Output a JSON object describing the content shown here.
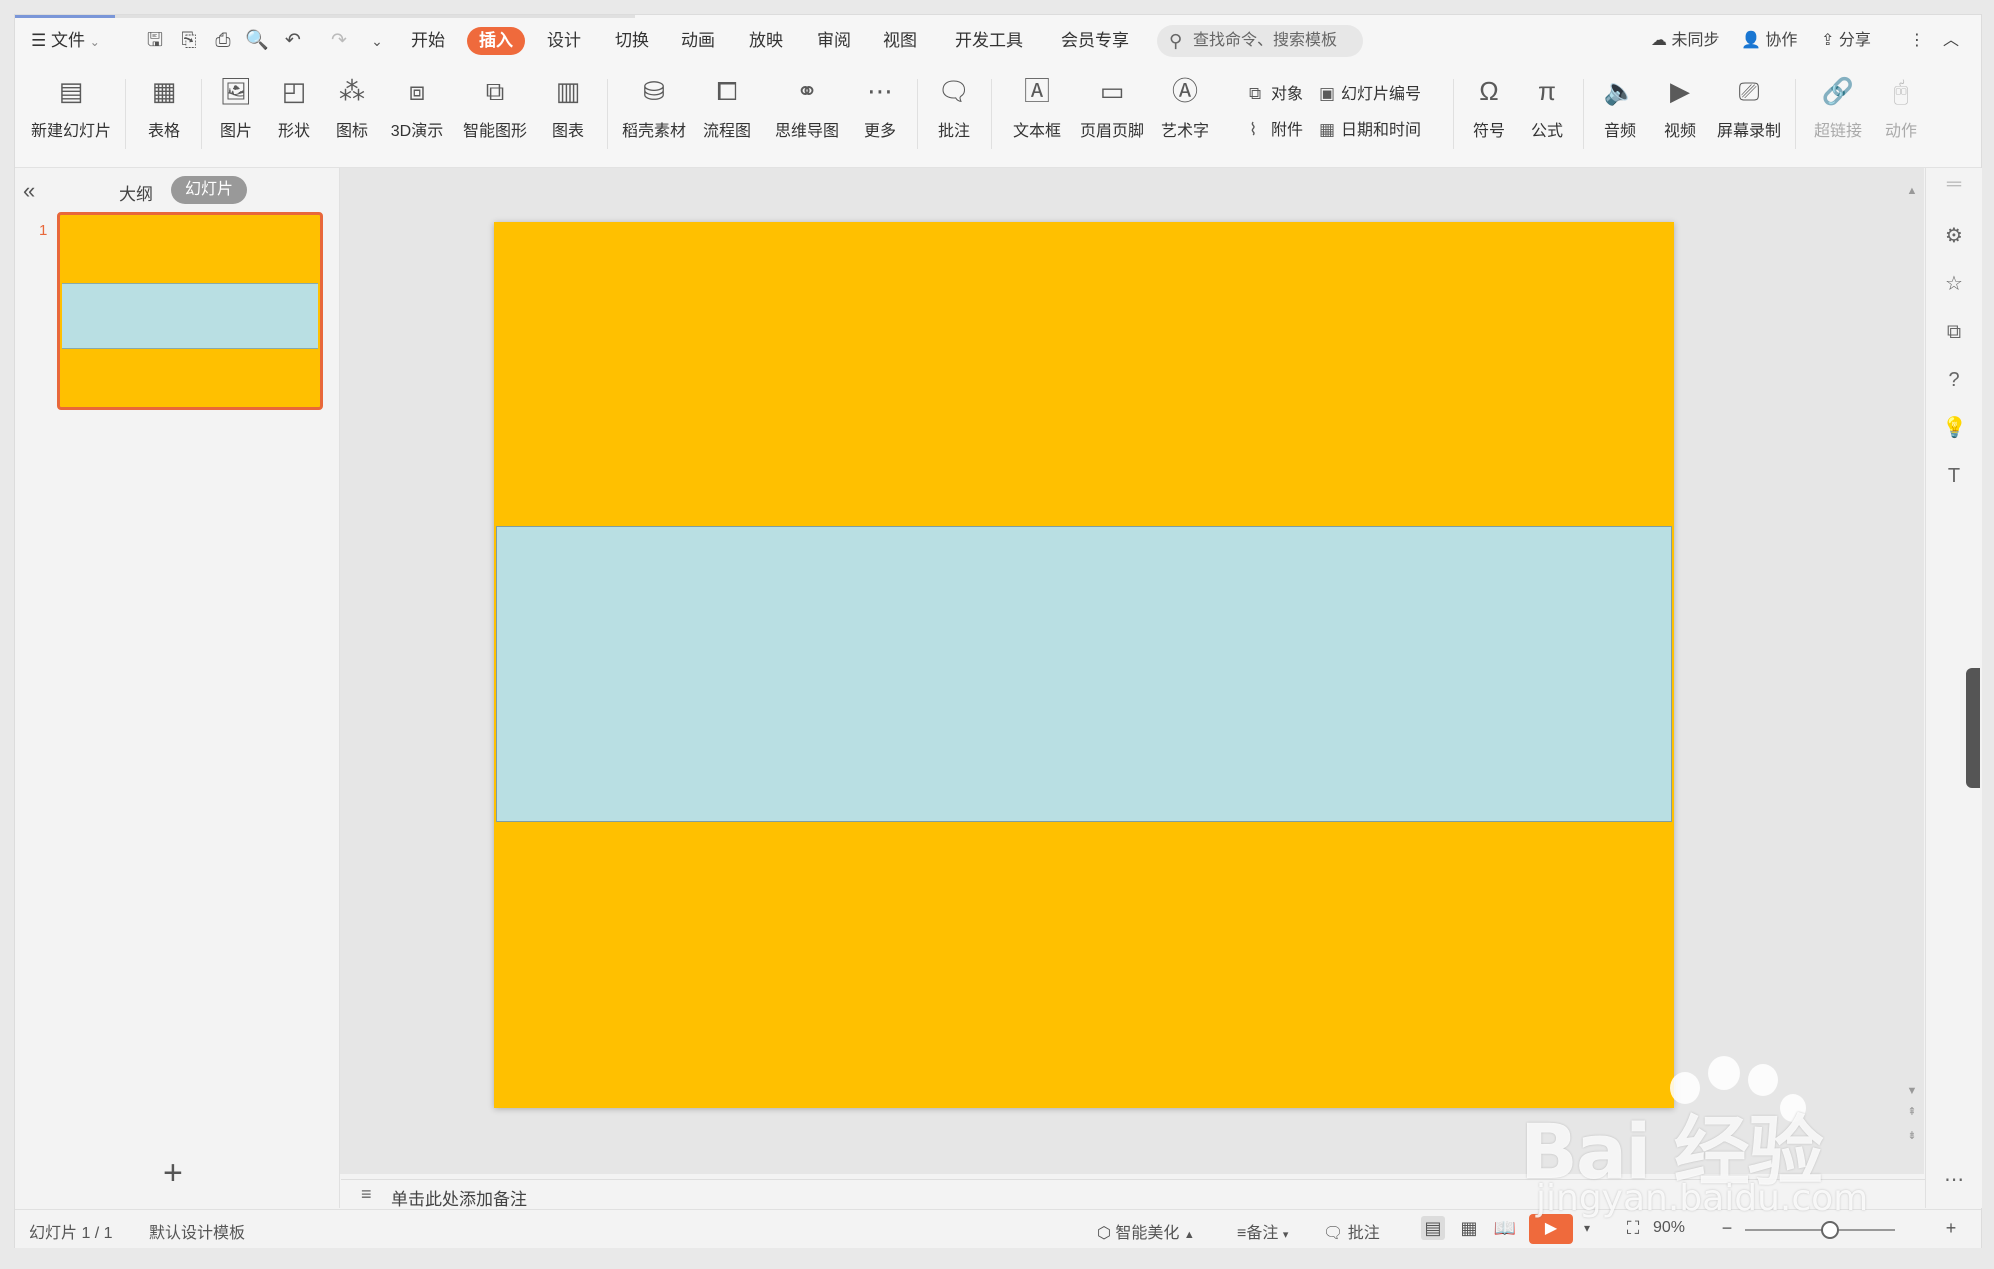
{
  "menu": {
    "file": "文件",
    "tabs": [
      "开始",
      "插入",
      "设计",
      "切换",
      "动画",
      "放映",
      "审阅",
      "视图",
      "开发工具",
      "会员专享"
    ],
    "active_tab": "插入",
    "search_placeholder": "查找命令、搜索模板",
    "right": {
      "sync": "未同步",
      "collab": "协作",
      "share": "分享"
    }
  },
  "ribbon": {
    "new_slide": "新建幻灯片",
    "table": "表格",
    "picture": "图片",
    "shape": "形状",
    "icon": "图标",
    "three_d": "3D演示",
    "smartart": "智能图形",
    "chart": "图表",
    "docer": "稻壳素材",
    "flowchart": "流程图",
    "mindmap": "思维导图",
    "more": "更多",
    "comment": "批注",
    "textbox": "文本框",
    "header_footer": "页眉页脚",
    "wordart": "艺术字",
    "object": "对象",
    "attachment": "附件",
    "slide_number": "幻灯片编号",
    "date_time": "日期和时间",
    "symbol": "符号",
    "formula": "公式",
    "audio": "音频",
    "video": "视频",
    "screen_record": "屏幕录制",
    "hyperlink": "超链接",
    "action": "动作"
  },
  "left_panel": {
    "outline_tab": "大纲",
    "slides_tab": "幻灯片",
    "slide_number": "1"
  },
  "colors": {
    "slide_bg": "#ffc000",
    "band": "#b9dfe3",
    "accent": "#ef6a3c"
  },
  "notes_placeholder": "单击此处添加备注",
  "status": {
    "slide_info": "幻灯片 1 / 1",
    "template": "默认设计模板",
    "beautify": "智能美化",
    "notes": "备注",
    "comment": "批注",
    "zoom": "90%"
  },
  "watermark": {
    "main": "Bai  经验",
    "sub": "jingyan.baidu.com"
  }
}
